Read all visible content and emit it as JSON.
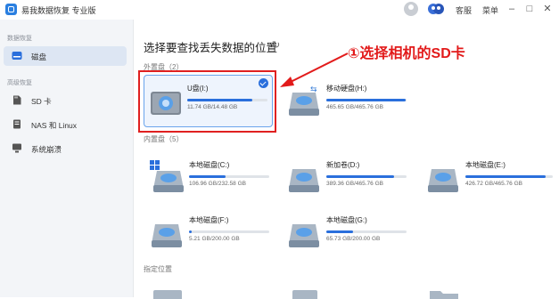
{
  "titlebar": {
    "app_title": "易我数据恢复 专业版",
    "service_label": "客服",
    "menu_label": "菜单"
  },
  "sidebar": {
    "section1_title": "数据恢复",
    "section2_title": "高级恢复",
    "items": [
      {
        "label": "磁盘",
        "icon": "drive-icon",
        "active": true
      },
      {
        "label": "SD 卡",
        "icon": "sd-card-icon",
        "active": false
      },
      {
        "label": "NAS 和 Linux",
        "icon": "nas-icon",
        "active": false
      },
      {
        "label": "系统崩溃",
        "icon": "system-crash-icon",
        "active": false
      }
    ]
  },
  "main": {
    "title": "选择要查找丢失数据的位置",
    "external_section": "外置盘（2）",
    "internal_section": "内置盘（5）",
    "location_section": "指定位置",
    "annotation": "①选择相机的SD卡",
    "external_drives": [
      {
        "name": "U盘(I:)",
        "size": "11.74 GB/14.48 GB",
        "used_fraction": 0.81,
        "selected": true
      },
      {
        "name": "移动硬盘(H:)",
        "size": "465.65 GB/465.76 GB",
        "used_fraction": 0.99,
        "selected": false
      }
    ],
    "internal_drives": [
      {
        "name": "本地磁盘(C:)",
        "size": "106.96 GB/232.58 GB",
        "used_fraction": 0.46
      },
      {
        "name": "新加卷(D:)",
        "size": "389.36 GB/465.76 GB",
        "used_fraction": 0.84
      },
      {
        "name": "本地磁盘(E:)",
        "size": "426.72 GB/465.76 GB",
        "used_fraction": 0.92
      },
      {
        "name": "本地磁盘(F:)",
        "size": "5.21 GB/200.00 GB",
        "used_fraction": 0.03
      },
      {
        "name": "本地磁盘(G:)",
        "size": "65.73 GB/200.00 GB",
        "used_fraction": 0.33
      }
    ]
  },
  "colors": {
    "accent": "#2a6fdc",
    "annotation": "#e21a1a"
  }
}
